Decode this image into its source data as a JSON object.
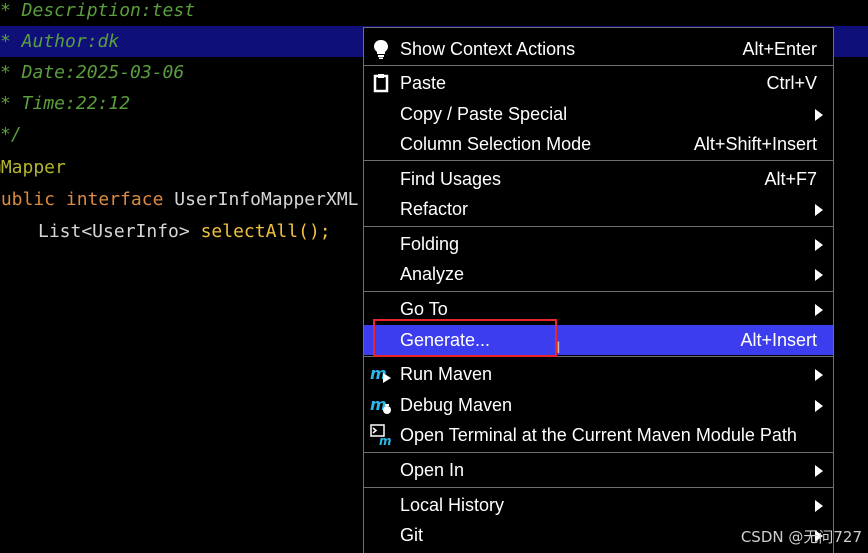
{
  "editor": {
    "lines": [
      "* Description:test",
      "* Author:dk",
      "* Date:2025-03-06",
      "* Time:22:12",
      "*/",
      "@Mapper",
      "public",
      "interface",
      "UserInfoMapperXML",
      "List<UserInfo>",
      "selectAll",
      "();"
    ]
  },
  "menu": {
    "items": [
      {
        "label": "Show Context Actions",
        "shortcut": "Alt+Enter",
        "icon": "lightbulb-icon"
      },
      {
        "label": "Paste",
        "shortcut": "Ctrl+V",
        "icon": "clipboard-icon"
      },
      {
        "label": "Copy / Paste Special",
        "submenu": true
      },
      {
        "label": "Column Selection Mode",
        "shortcut": "Alt+Shift+Insert"
      },
      {
        "label": "Find Usages",
        "shortcut": "Alt+F7"
      },
      {
        "label": "Refactor",
        "submenu": true
      },
      {
        "label": "Folding",
        "submenu": true
      },
      {
        "label": "Analyze",
        "submenu": true
      },
      {
        "label": "Go To",
        "submenu": true
      },
      {
        "label": "Generate...",
        "shortcut": "Alt+Insert",
        "selected": true
      },
      {
        "label": "Run Maven",
        "submenu": true,
        "icon": "maven-run-icon"
      },
      {
        "label": "Debug Maven",
        "submenu": true,
        "icon": "maven-debug-icon"
      },
      {
        "label": "Open Terminal at the Current Maven Module Path",
        "icon": "terminal-maven-icon"
      },
      {
        "label": "Open In",
        "submenu": true
      },
      {
        "label": "Local History",
        "submenu": true
      },
      {
        "label": "Git",
        "submenu": true
      }
    ]
  },
  "colors": {
    "selected": "#3d3df0",
    "highlight_line": "#0f0f7a",
    "annotation_box": "#e8262a"
  },
  "watermark": "CSDN @无问727"
}
